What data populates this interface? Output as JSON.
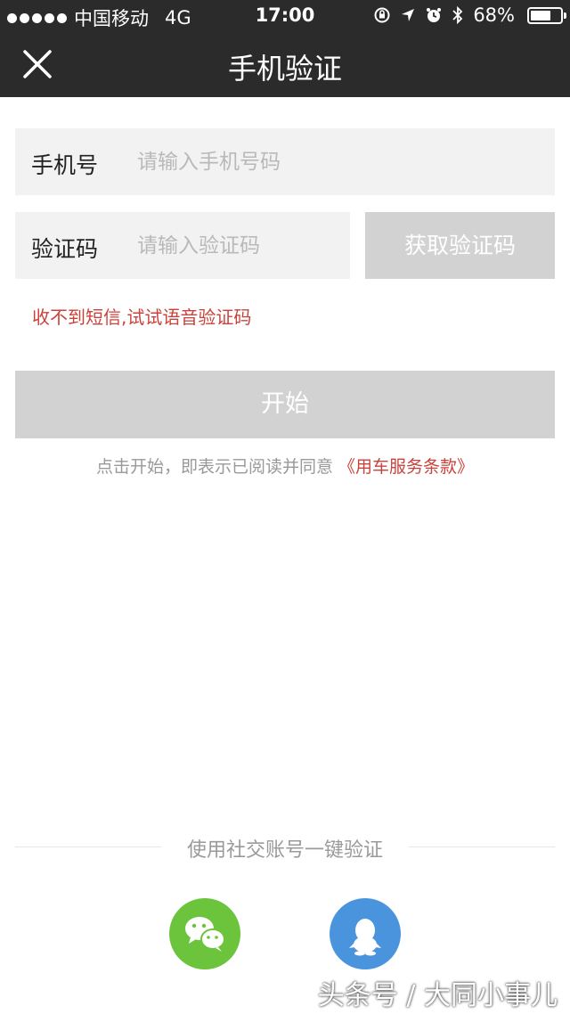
{
  "status_bar": {
    "carrier": "中国移动",
    "network": "4G",
    "time": "17:00",
    "battery": "68%",
    "battery_level": 0.68
  },
  "header": {
    "title": "手机验证",
    "close_icon": "close-icon"
  },
  "form": {
    "phone": {
      "label": "手机号",
      "placeholder": "请输入手机号码"
    },
    "code": {
      "label": "验证码",
      "placeholder": "请输入验证码"
    },
    "get_code_label": "获取验证码",
    "voice_link": "收不到短信,试试语音验证码",
    "start_label": "开始",
    "agree_text": "点击开始，即表示已阅读并同意",
    "terms_link": "《用车服务条款》"
  },
  "social": {
    "label": "使用社交账号一键验证",
    "buttons": [
      {
        "icon": "wechat-icon",
        "color": "#6cc43c"
      },
      {
        "icon": "qq-icon",
        "color": "#4a94dd"
      }
    ]
  },
  "watermark": "头条号 / 大同小事儿",
  "colors": {
    "header_bg": "#2b2b2b",
    "accent_red": "#c9433c",
    "disabled_button": "#d2d2d2",
    "field_bg": "#f2f2f2"
  }
}
